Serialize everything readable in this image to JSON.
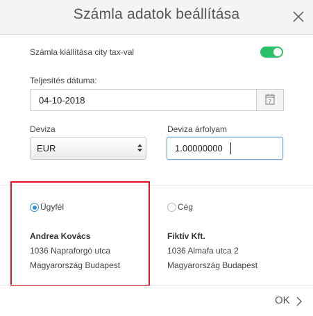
{
  "dialog": {
    "title": "Számla adatok beállítása",
    "close_icon": "close-icon"
  },
  "city_tax": {
    "label": "Számla kiállítása city tax-val",
    "enabled": true,
    "toggle_color": "#2bbf6a"
  },
  "completion_date": {
    "label": "Teljesítés dátuma:",
    "value": "04-10-2018",
    "calendar_icon": "calendar-icon",
    "calendar_day": "7"
  },
  "currency": {
    "label": "Deviza",
    "selected": "EUR",
    "icon": "updown-arrows-icon"
  },
  "exchange_rate": {
    "label": "Deviza árfolyam",
    "value": "1.00000000"
  },
  "billing": {
    "options": [
      {
        "label": "Ügyfél",
        "selected": true,
        "name": "Andrea Kovács",
        "address_line1": "1036 Napraforgó utca",
        "address_line2": "Magyarország Budapest"
      },
      {
        "label": "Cég",
        "selected": false,
        "name": "Fiktív Kft.",
        "address_line1": "1036 Almafa utca 2",
        "address_line2": "Magyarország Budapest"
      }
    ],
    "highlight_color": "#e0161c",
    "radio_color": "#3b8ed8"
  },
  "footer": {
    "ok_label": "OK",
    "ok_icon": "chevron-right-icon"
  }
}
